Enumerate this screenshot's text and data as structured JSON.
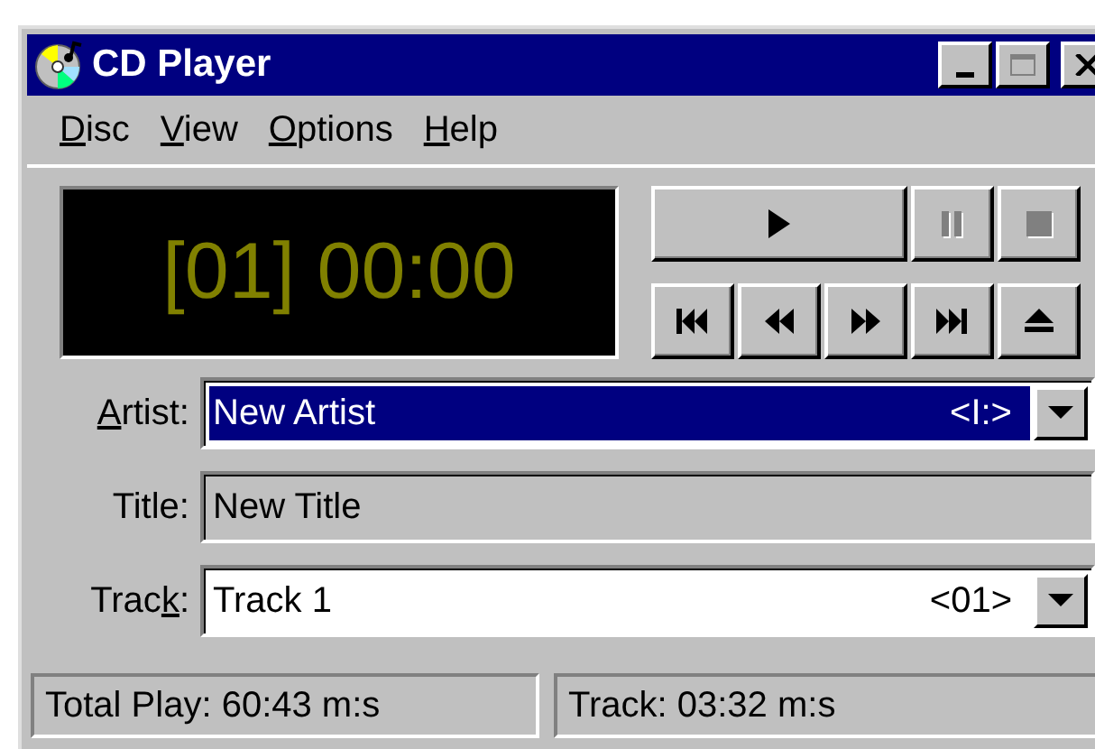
{
  "window": {
    "title": "CD Player",
    "controls": [
      {
        "kind": "minimize",
        "disabled": false
      },
      {
        "kind": "maximize",
        "disabled": true
      },
      {
        "kind": "close",
        "disabled": false
      }
    ]
  },
  "menu": [
    {
      "key": "D",
      "after": "isc"
    },
    {
      "key": "V",
      "after": "iew"
    },
    {
      "key": "O",
      "after": "ptions"
    },
    {
      "key": "H",
      "after": "elp"
    }
  ],
  "display": {
    "text": "[01] 00:00"
  },
  "transport": [
    {
      "kind": "play",
      "disabled": false
    },
    {
      "kind": "pause",
      "disabled": true
    },
    {
      "kind": "stop",
      "disabled": true
    },
    {
      "kind": "previous-track",
      "disabled": false
    },
    {
      "kind": "rewind",
      "disabled": false
    },
    {
      "kind": "fast-forward",
      "disabled": false
    },
    {
      "kind": "next-track",
      "disabled": false
    },
    {
      "kind": "eject",
      "disabled": false
    }
  ],
  "fields": [
    {
      "label": {
        "key": "A",
        "after": "rtist:"
      },
      "kind": "combo",
      "value": "New Artist",
      "tag": "<I:>",
      "highlighted": true
    },
    {
      "label": {
        "before": "Title:"
      },
      "kind": "text",
      "value": "New Title",
      "highlighted": false
    },
    {
      "label": {
        "before": "Trac",
        "key": "k",
        "after": ":"
      },
      "kind": "combo",
      "value": "Track 1",
      "tag": "<01>",
      "highlighted": false
    }
  ],
  "status_bar": [
    "Total Play: 60:43 m:s",
    "Track: 03:32 m:s"
  ]
}
